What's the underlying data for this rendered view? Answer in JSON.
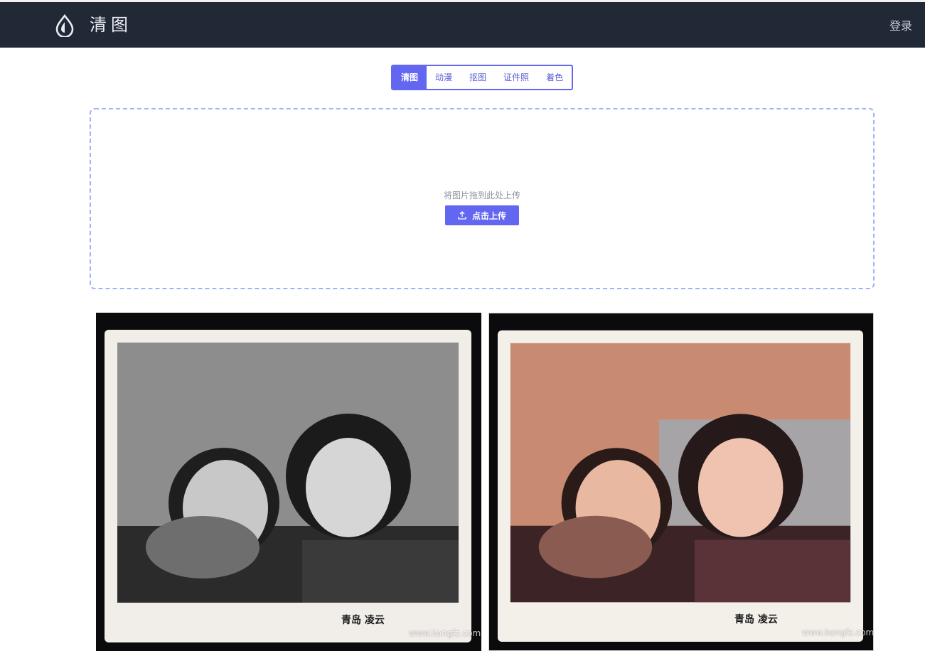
{
  "header": {
    "app_name": "清图",
    "logo_icon": "water-drop-icon",
    "login_label": "登录",
    "background": "#212836"
  },
  "tabs": [
    {
      "label": "清图",
      "active": true
    },
    {
      "label": "动漫",
      "active": false
    },
    {
      "label": "抠图",
      "active": false
    },
    {
      "label": "证件照",
      "active": false
    },
    {
      "label": "着色",
      "active": false
    }
  ],
  "upload": {
    "hint": "将图片拖到此处上传",
    "button_label": "点击上传",
    "button_icon": "upload-icon",
    "accent": "#6366f1"
  },
  "examples": {
    "before_brand": "青岛 凌云",
    "after_brand": "青岛 凌云",
    "watermark": "www.kongfz.com"
  }
}
